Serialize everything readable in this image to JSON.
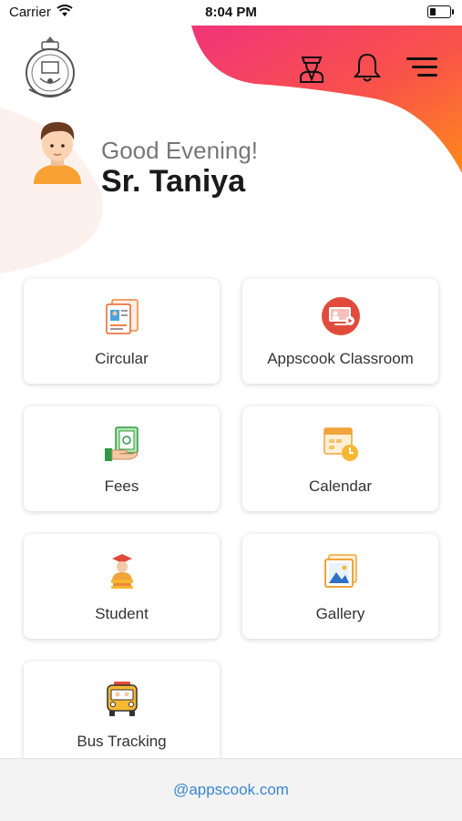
{
  "status_bar": {
    "carrier": "Carrier",
    "time": "8:04 PM"
  },
  "header": {
    "icons": [
      "teacher-icon",
      "bell-icon",
      "menu-icon"
    ],
    "greeting": "Good Evening!",
    "user_name": "Sr. Taniya"
  },
  "menu": {
    "items": [
      {
        "label": "Circular",
        "icon": "circular-icon"
      },
      {
        "label": "Appscook Classroom",
        "icon": "classroom-icon"
      },
      {
        "label": "Fees",
        "icon": "fees-icon"
      },
      {
        "label": "Calendar",
        "icon": "calendar-icon"
      },
      {
        "label": "Student",
        "icon": "student-icon"
      },
      {
        "label": "Gallery",
        "icon": "gallery-icon"
      },
      {
        "label": "Bus Tracking",
        "icon": "bus-icon"
      }
    ]
  },
  "footer": {
    "link": "@appscook.com"
  },
  "colors": {
    "accent_start": "#f0347a",
    "accent_end": "#ff7a1a",
    "link": "#3a86d0"
  }
}
